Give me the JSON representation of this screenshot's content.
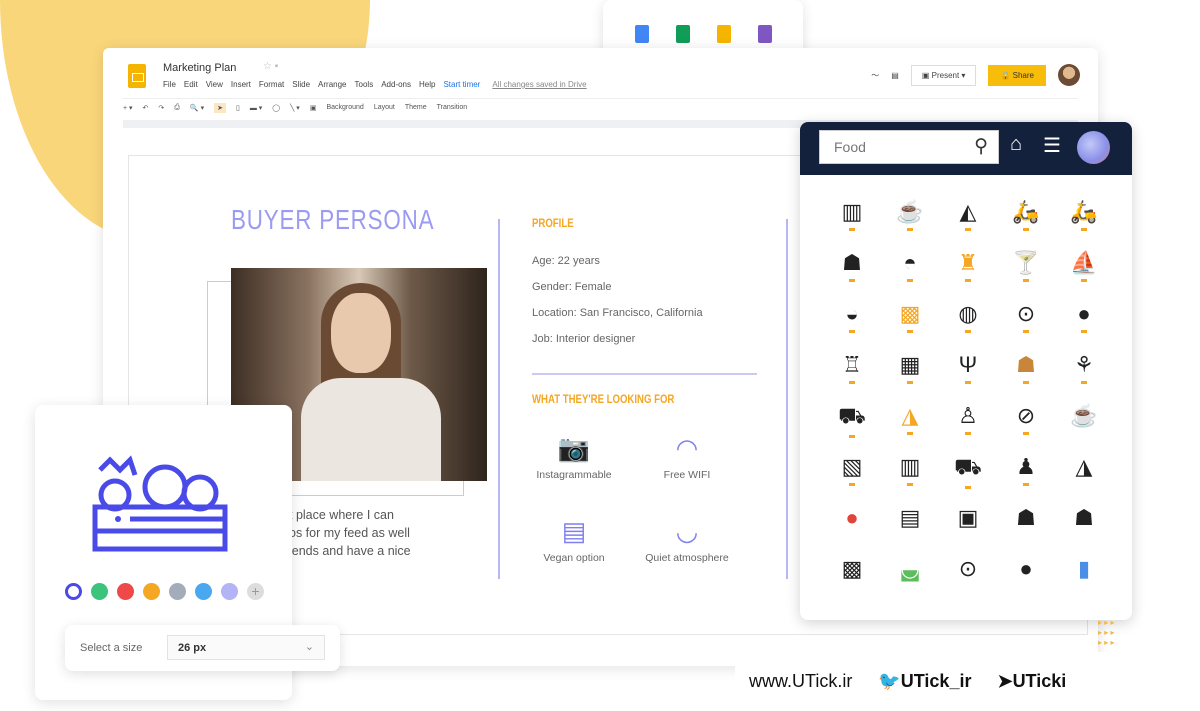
{
  "app": {
    "doc_title": "Marketing Plan",
    "menu": [
      "File",
      "Edit",
      "View",
      "Insert",
      "Format",
      "Slide",
      "Arrange",
      "Tools",
      "Add-ons",
      "Help"
    ],
    "start_timer": "Start timer",
    "save_status": "All changes saved in Drive",
    "toolbar": {
      "background": "Background",
      "layout": "Layout",
      "theme": "Theme",
      "transition": "Transition"
    },
    "present_label": "Present",
    "share_label": "Share"
  },
  "slide": {
    "title": "BUYER PERSONA",
    "profile_heading": "PROFILE",
    "profile": [
      "Age: 22 years",
      "Gender: Female",
      "Location: San Francisco, California",
      "Job: Interior designer"
    ],
    "looking_heading": "WHAT THEY'RE LOOKING FOR",
    "features": [
      {
        "label": "Instagrammable",
        "icon": "camera-icon"
      },
      {
        "label": "Free WIFI",
        "icon": "wifi-icon"
      },
      {
        "label": "Vegan option",
        "icon": "vegan-food-icon"
      },
      {
        "label": "Quiet atmosphere",
        "icon": "bowl-icon"
      }
    ],
    "quote_lines": [
      "t place where I can",
      "os for my feed as well",
      "iends and have a nice"
    ]
  },
  "icon_panel": {
    "search_value": "Food",
    "icons": [
      "sushi",
      "coffee-cup",
      "pizza-slice",
      "delivery-scooter",
      "delivery-scooter",
      "burger",
      "cloche",
      "oil-bottle",
      "cocktail",
      "sushi-boat",
      "bread",
      "toast",
      "steak",
      "plate-cutlery",
      "apple",
      "cake",
      "cake-layers",
      "cutlery",
      "burger",
      "drinks",
      "food-truck",
      "pizza",
      "serving",
      "skewer",
      "coffee-cup",
      "basket",
      "sushi",
      "scooter",
      "mixer",
      "pizza",
      "apple",
      "menu",
      "recipe",
      "burger",
      "burger",
      "toast",
      "salad",
      "plate-cutlery",
      "apple",
      "bottle"
    ],
    "highlighted": [
      0,
      1,
      2,
      3,
      4,
      5,
      6,
      7,
      8,
      9,
      10,
      11,
      12,
      13,
      14,
      15,
      16,
      17,
      18,
      19,
      20,
      21,
      22,
      23,
      25,
      26,
      27,
      28
    ]
  },
  "color_picker": {
    "colors": [
      "#4a4ae8",
      "#3cc47c",
      "#f04848",
      "#f5a623",
      "#a3acb9",
      "#4aa8f0",
      "#b3b3f5"
    ],
    "selected": "#4a4ae8"
  },
  "size_select": {
    "label": "Select a size",
    "value": "26 px"
  },
  "watermark": {
    "site": "www.UTick.ir",
    "twitter": "UTick_ir",
    "telegram": "UTicki"
  }
}
